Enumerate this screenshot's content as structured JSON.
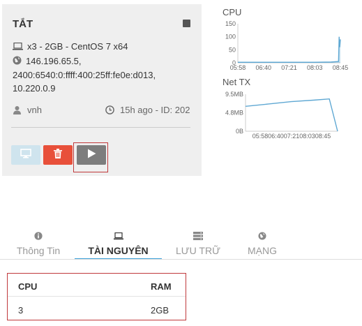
{
  "server": {
    "status": "TẮT",
    "spec": "x3 - 2GB - CentOS 7 x64",
    "ip_lines": [
      "146.196.65.5,",
      "2400:6540:0:ffff:400:25ff:fe0e:d013,",
      "10.220.0.9"
    ],
    "owner": "vnh",
    "time_id": "15h ago - ID: 202"
  },
  "actions": {
    "console_icon": "monitor-icon",
    "delete_icon": "trash-icon",
    "start_icon": "play-icon"
  },
  "chart_data": [
    {
      "type": "area",
      "title": "CPU",
      "ylim": [
        0,
        150
      ],
      "y_ticks": [
        "150",
        "100",
        "50",
        "0"
      ],
      "x_tick_labels": [
        "05:58",
        "06:40",
        "07:21",
        "08:03",
        "08:45"
      ],
      "series": [
        {
          "x": [
            "05:58",
            "06:40",
            "07:21",
            "08:03",
            "08:30",
            "08:42",
            "08:43",
            "08:44",
            "08:45"
          ],
          "values": [
            2,
            2,
            2,
            2,
            3,
            5,
            100,
            60,
            90
          ]
        }
      ],
      "color": "#5fa8d3"
    },
    {
      "type": "line",
      "title": "Net TX",
      "ylim": [
        0,
        9.5
      ],
      "y_ticks": [
        "9.5MB",
        "4.8MB",
        "0B"
      ],
      "x_tick_labels_text": "05:5806:4007:2108:0308:45",
      "series": [
        {
          "x": [
            "05:58",
            "06:40",
            "07:21",
            "08:03",
            "08:30",
            "08:45"
          ],
          "values": [
            6.4,
            7.0,
            7.6,
            8.0,
            8.3,
            0
          ]
        }
      ],
      "color": "#5fa8d3"
    }
  ],
  "tabs": [
    {
      "label": "Thông Tin",
      "icon": "info-icon",
      "active": false
    },
    {
      "label": "TÀI NGUYÊN",
      "icon": "laptop-icon",
      "active": true
    },
    {
      "label": "LƯU TRỮ",
      "icon": "storage-icon",
      "active": false
    },
    {
      "label": "MẠNG",
      "icon": "globe-icon",
      "active": false
    }
  ],
  "resources": {
    "headers": [
      "CPU",
      "RAM"
    ],
    "row": [
      "3",
      "2GB"
    ]
  },
  "colors": {
    "accent": "#3a9fd8",
    "danger": "#e8503a",
    "highlight": "#c0393b"
  }
}
